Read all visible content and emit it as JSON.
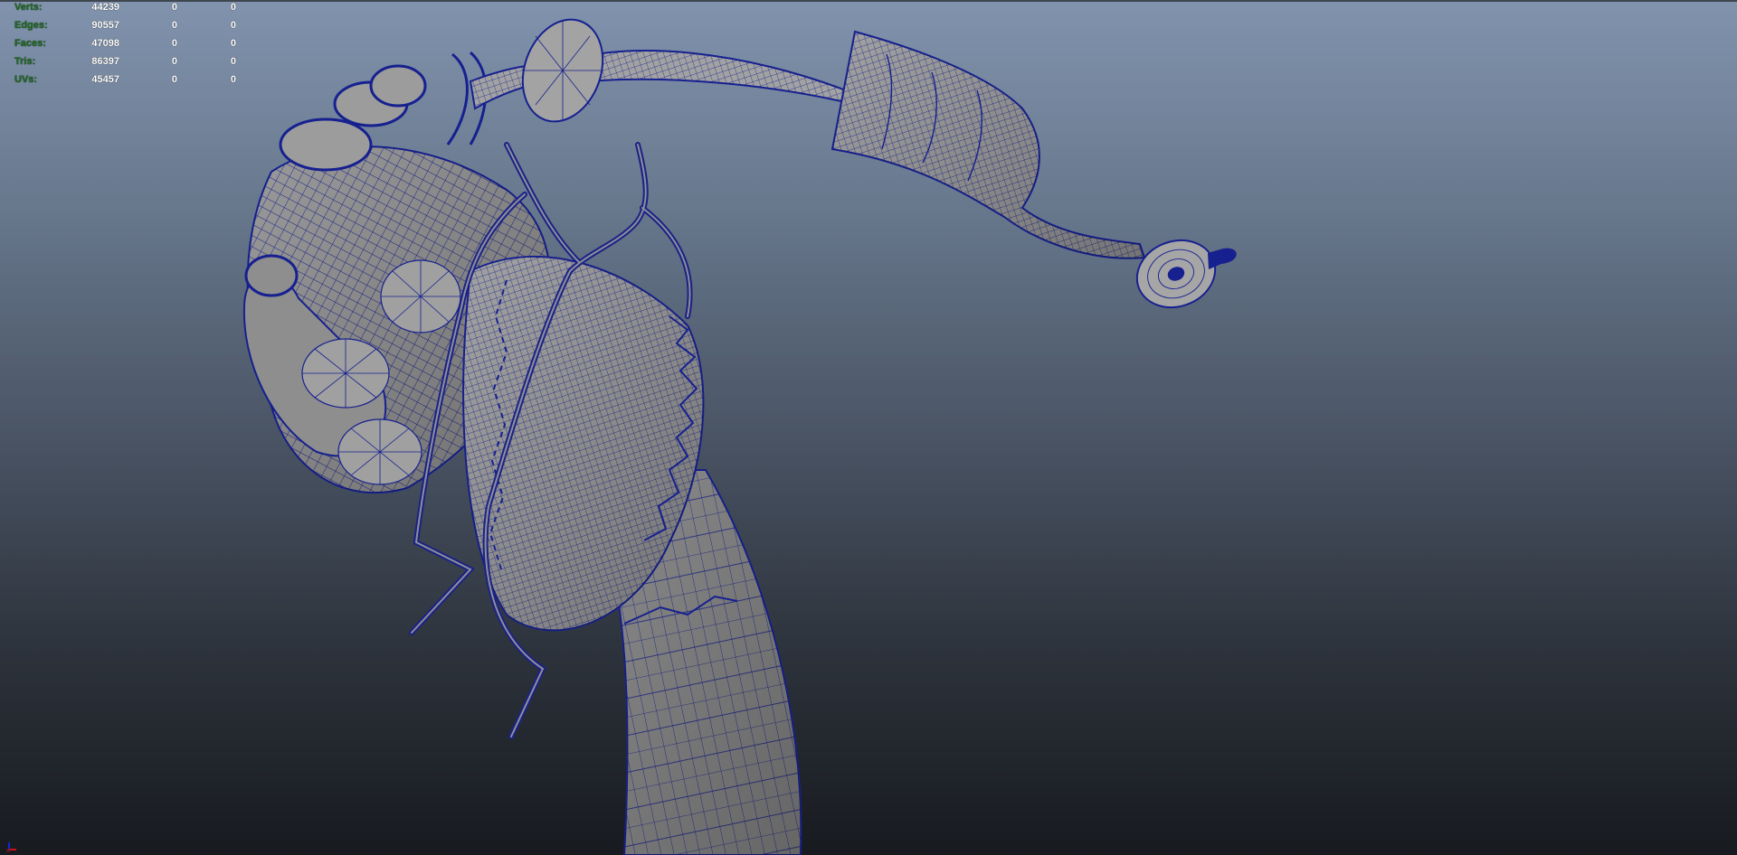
{
  "hud": {
    "rows": [
      {
        "label": "Verts:",
        "values": [
          "44239",
          "0",
          "0"
        ]
      },
      {
        "label": "Edges:",
        "values": [
          "90557",
          "0",
          "0"
        ]
      },
      {
        "label": "Faces:",
        "values": [
          "47098",
          "0",
          "0"
        ]
      },
      {
        "label": "Tris:",
        "values": [
          "86397",
          "0",
          "0"
        ]
      },
      {
        "label": "UVs:",
        "values": [
          "45457",
          "0",
          "0"
        ]
      }
    ]
  },
  "colors": {
    "wire": "#161f8c",
    "shade": "#9b9b9b",
    "shade_dark": "#6f7176",
    "bg_top": "#8193ad",
    "bg_bottom": "#171a1f",
    "gizmo_x": "#d01010",
    "gizmo_y": "#1028d0"
  },
  "viewport": {
    "content": "wireframe-on-shaded 3D model"
  }
}
